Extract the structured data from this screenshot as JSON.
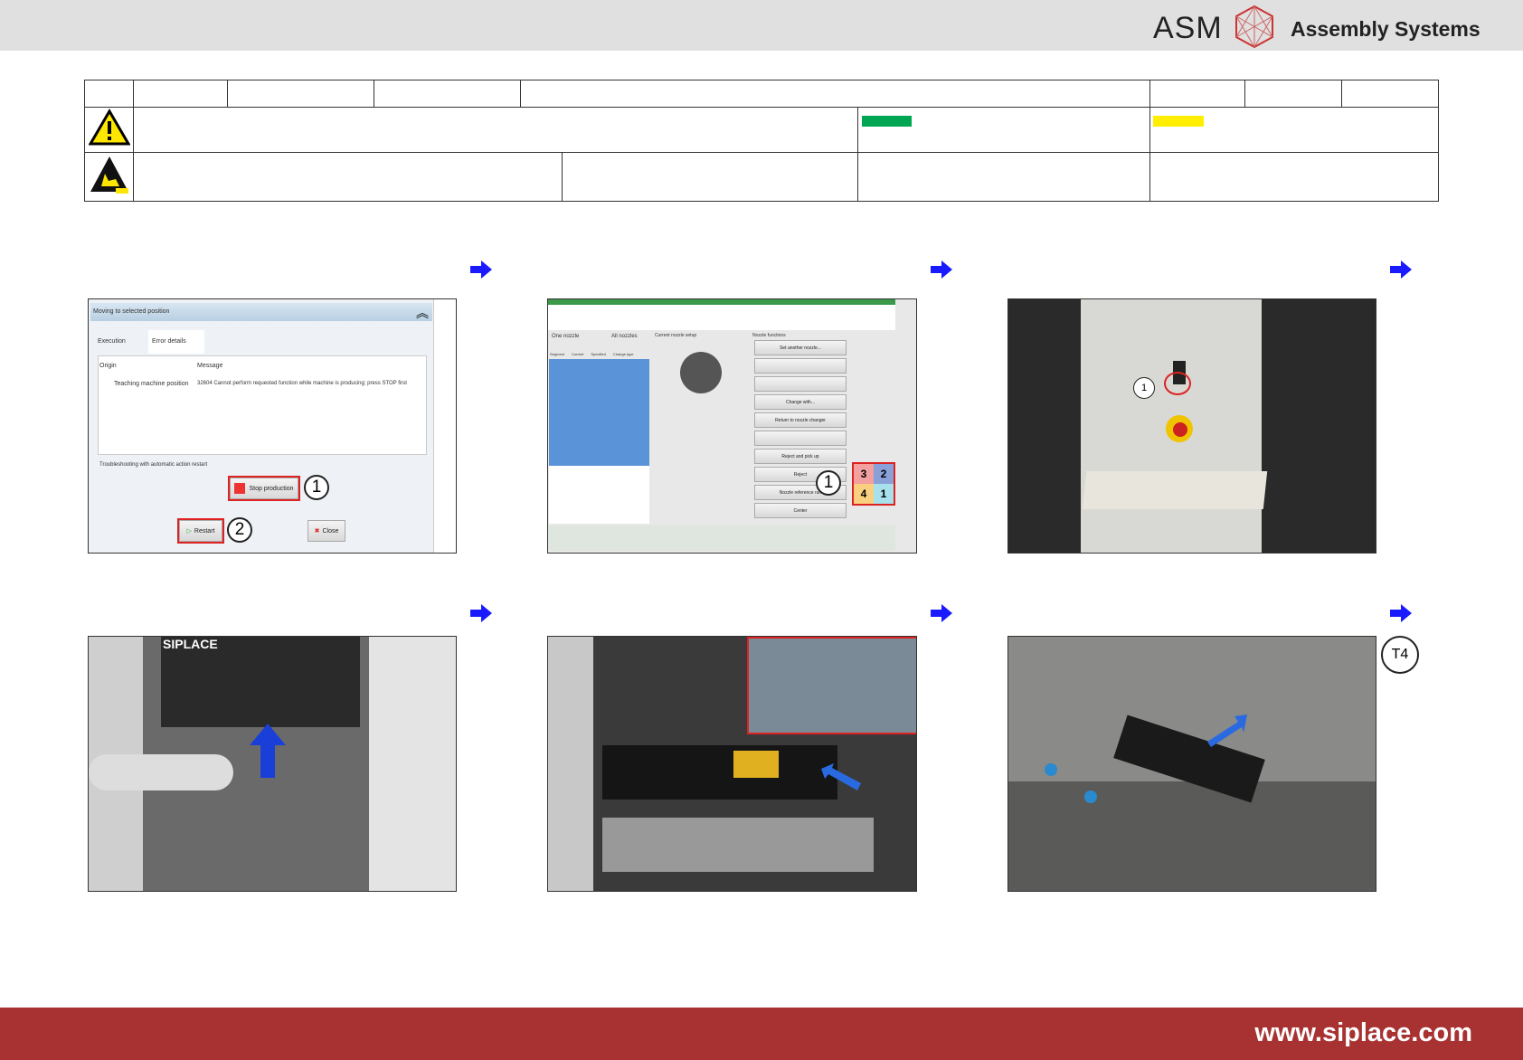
{
  "header": {
    "brand": "ASM",
    "brand_sub": "Assembly Systems"
  },
  "colors": {
    "green": "#00a651",
    "yellow": "#ffee00",
    "footer": "#a83232",
    "arrow": "#1a1aff"
  },
  "screen1": {
    "title": "Moving to selected position",
    "tabs": [
      "Execution",
      "Error details"
    ],
    "columns": [
      "Origin",
      "Message"
    ],
    "row": {
      "origin": "Teaching machine position",
      "message": "32604 Cannot perform requested function while machine is producing; press STOP first"
    },
    "troubleshoot": "Troubleshooting with automatic action restart",
    "stop_button": "Stop production",
    "restart_button": "Restart",
    "close_button": "Close",
    "callouts": [
      "1",
      "2"
    ]
  },
  "screen2": {
    "tabs": [
      "One nozzle",
      "All nozzles"
    ],
    "panel_titles": [
      "Current nozzle setup",
      "Nozzle functions"
    ],
    "columns": [
      "Segment",
      "Current",
      "Specified",
      "Change type"
    ],
    "functions": [
      "Set another nozzle...",
      "",
      "",
      "Change with...",
      "Return to nozzle changer",
      "",
      "Reject and pick up",
      "Reject",
      "Nozzle reference run",
      "Center"
    ],
    "quadrants": [
      "3",
      "2",
      "4",
      "1"
    ],
    "callout": "1"
  },
  "screen3": {
    "callout": "1"
  },
  "screen4": {
    "label": "SIPLACE"
  },
  "screen6": {
    "tool": "T4"
  },
  "footer": {
    "url": "www.siplace.com"
  }
}
